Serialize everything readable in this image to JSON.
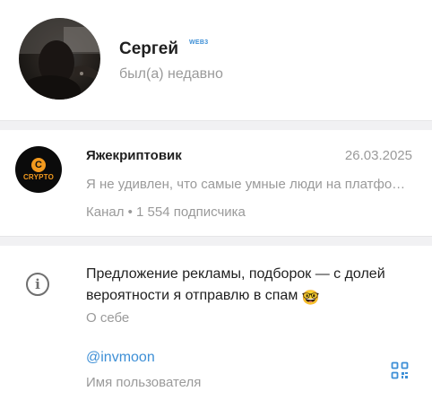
{
  "profile": {
    "name": "Сергей",
    "badge": "WEB3",
    "status": "был(а) недавно"
  },
  "channel": {
    "logo_letter": "C",
    "logo_text": "CRYPTO",
    "name": "Яжекриптовик",
    "date": "26.03.2025",
    "preview": "Я не удивлен, что самые умные люди на платформе",
    "meta": "Канал • 1 554 подписчика"
  },
  "bio": {
    "text": "Предложение рекламы, подборок — с долей вероятности я отправлю в спам",
    "emoji": "🤓",
    "label": "О себе"
  },
  "username": {
    "value": "@invmoon",
    "label": "Имя пользователя"
  },
  "colors": {
    "accent": "#3d8fd6",
    "channel_logo": "#f39a1e",
    "secondary_text": "#9a9a9a"
  },
  "icons": {
    "info": "info-circle-icon",
    "qr": "qr-code-icon"
  }
}
